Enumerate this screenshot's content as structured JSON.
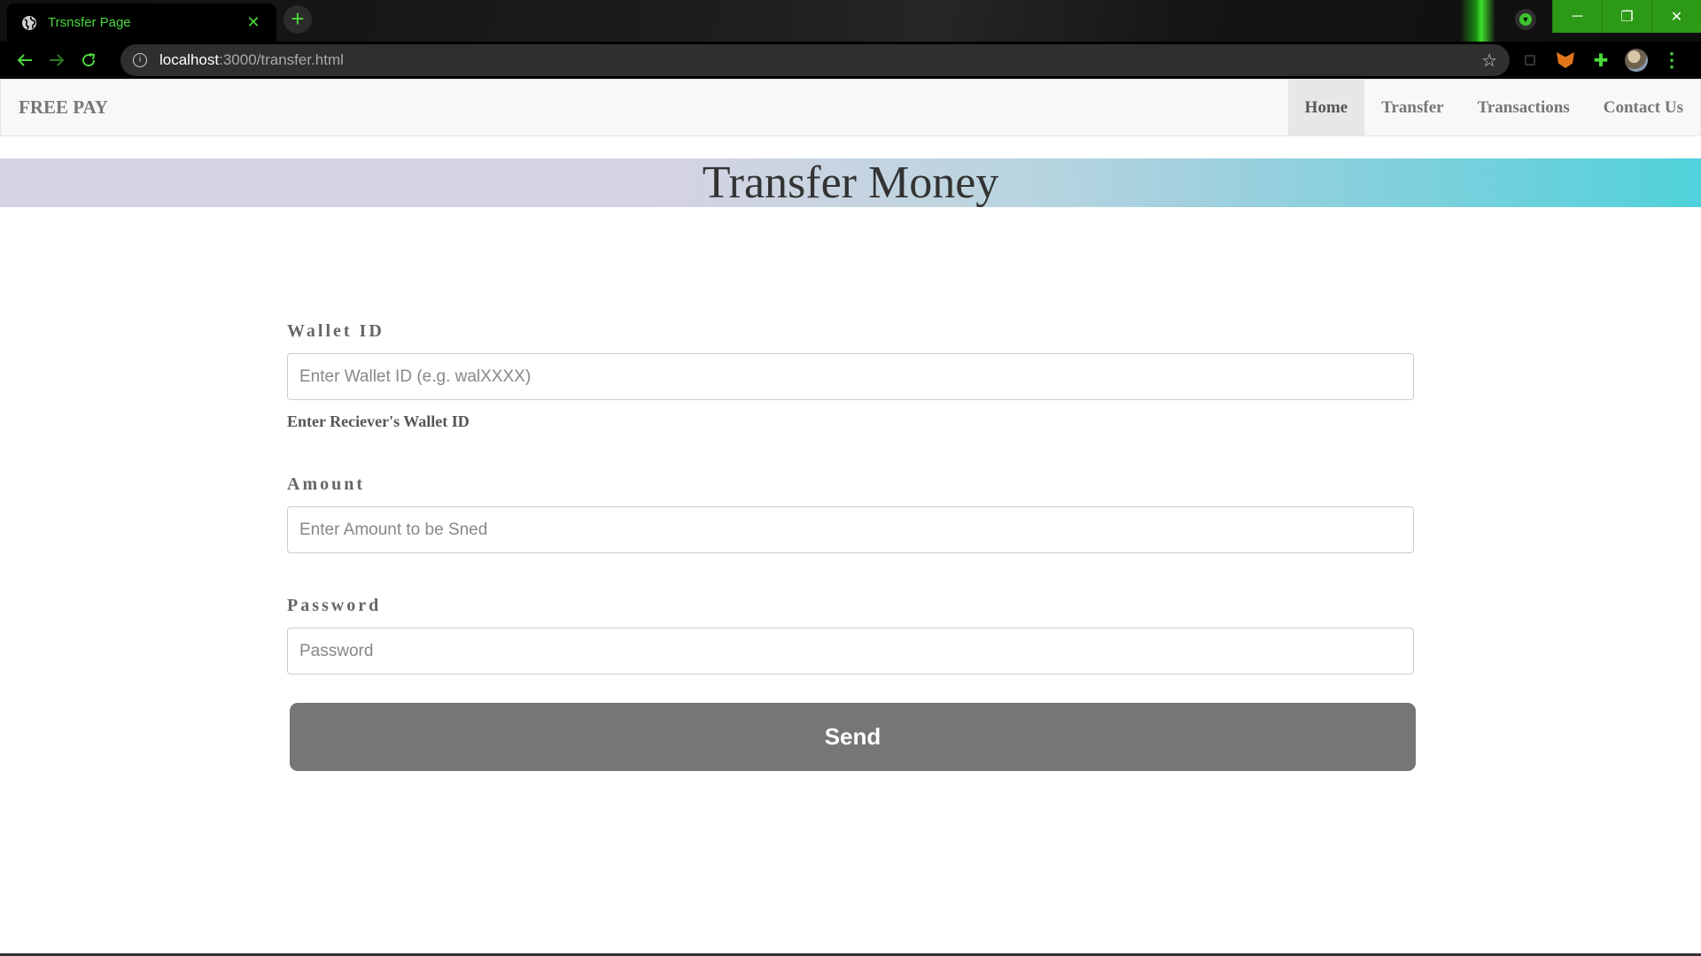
{
  "browser": {
    "tab_title": "Trsnsfer Page",
    "tab_close": "✕",
    "new_tab": "+",
    "url_host": "localhost",
    "url_path": ":3000/transfer.html",
    "window_controls": {
      "minimize": "─",
      "maximize": "❐",
      "close": "✕"
    },
    "accent": "#4ad93c"
  },
  "navbar": {
    "brand": "FREE PAY",
    "links": [
      {
        "label": "Home",
        "active": true
      },
      {
        "label": "Transfer",
        "active": false
      },
      {
        "label": "Transactions",
        "active": false
      },
      {
        "label": "Contact Us",
        "active": false
      }
    ]
  },
  "hero": {
    "title": "Transfer Money"
  },
  "form": {
    "wallet": {
      "label": "Wallet ID",
      "placeholder": "Enter Wallet ID (e.g. walXXXX)",
      "value": "",
      "help": "Enter Reciever's Wallet ID"
    },
    "amount": {
      "label": "Amount",
      "placeholder": "Enter Amount to be Sned",
      "value": ""
    },
    "password": {
      "label": "Password",
      "placeholder": "Password",
      "value": ""
    },
    "submit_label": "Send",
    "button_color": "#767577"
  }
}
